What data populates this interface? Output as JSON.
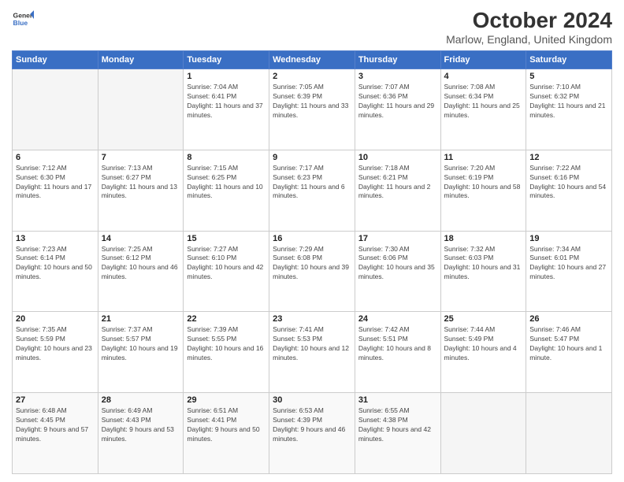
{
  "header": {
    "logo_line1": "General",
    "logo_line2": "Blue",
    "title": "October 2024",
    "subtitle": "Marlow, England, United Kingdom"
  },
  "weekdays": [
    "Sunday",
    "Monday",
    "Tuesday",
    "Wednesday",
    "Thursday",
    "Friday",
    "Saturday"
  ],
  "weeks": [
    [
      {
        "day": "",
        "info": ""
      },
      {
        "day": "",
        "info": ""
      },
      {
        "day": "1",
        "info": "Sunrise: 7:04 AM\nSunset: 6:41 PM\nDaylight: 11 hours and 37 minutes."
      },
      {
        "day": "2",
        "info": "Sunrise: 7:05 AM\nSunset: 6:39 PM\nDaylight: 11 hours and 33 minutes."
      },
      {
        "day": "3",
        "info": "Sunrise: 7:07 AM\nSunset: 6:36 PM\nDaylight: 11 hours and 29 minutes."
      },
      {
        "day": "4",
        "info": "Sunrise: 7:08 AM\nSunset: 6:34 PM\nDaylight: 11 hours and 25 minutes."
      },
      {
        "day": "5",
        "info": "Sunrise: 7:10 AM\nSunset: 6:32 PM\nDaylight: 11 hours and 21 minutes."
      }
    ],
    [
      {
        "day": "6",
        "info": "Sunrise: 7:12 AM\nSunset: 6:30 PM\nDaylight: 11 hours and 17 minutes."
      },
      {
        "day": "7",
        "info": "Sunrise: 7:13 AM\nSunset: 6:27 PM\nDaylight: 11 hours and 13 minutes."
      },
      {
        "day": "8",
        "info": "Sunrise: 7:15 AM\nSunset: 6:25 PM\nDaylight: 11 hours and 10 minutes."
      },
      {
        "day": "9",
        "info": "Sunrise: 7:17 AM\nSunset: 6:23 PM\nDaylight: 11 hours and 6 minutes."
      },
      {
        "day": "10",
        "info": "Sunrise: 7:18 AM\nSunset: 6:21 PM\nDaylight: 11 hours and 2 minutes."
      },
      {
        "day": "11",
        "info": "Sunrise: 7:20 AM\nSunset: 6:19 PM\nDaylight: 10 hours and 58 minutes."
      },
      {
        "day": "12",
        "info": "Sunrise: 7:22 AM\nSunset: 6:16 PM\nDaylight: 10 hours and 54 minutes."
      }
    ],
    [
      {
        "day": "13",
        "info": "Sunrise: 7:23 AM\nSunset: 6:14 PM\nDaylight: 10 hours and 50 minutes."
      },
      {
        "day": "14",
        "info": "Sunrise: 7:25 AM\nSunset: 6:12 PM\nDaylight: 10 hours and 46 minutes."
      },
      {
        "day": "15",
        "info": "Sunrise: 7:27 AM\nSunset: 6:10 PM\nDaylight: 10 hours and 42 minutes."
      },
      {
        "day": "16",
        "info": "Sunrise: 7:29 AM\nSunset: 6:08 PM\nDaylight: 10 hours and 39 minutes."
      },
      {
        "day": "17",
        "info": "Sunrise: 7:30 AM\nSunset: 6:06 PM\nDaylight: 10 hours and 35 minutes."
      },
      {
        "day": "18",
        "info": "Sunrise: 7:32 AM\nSunset: 6:03 PM\nDaylight: 10 hours and 31 minutes."
      },
      {
        "day": "19",
        "info": "Sunrise: 7:34 AM\nSunset: 6:01 PM\nDaylight: 10 hours and 27 minutes."
      }
    ],
    [
      {
        "day": "20",
        "info": "Sunrise: 7:35 AM\nSunset: 5:59 PM\nDaylight: 10 hours and 23 minutes."
      },
      {
        "day": "21",
        "info": "Sunrise: 7:37 AM\nSunset: 5:57 PM\nDaylight: 10 hours and 19 minutes."
      },
      {
        "day": "22",
        "info": "Sunrise: 7:39 AM\nSunset: 5:55 PM\nDaylight: 10 hours and 16 minutes."
      },
      {
        "day": "23",
        "info": "Sunrise: 7:41 AM\nSunset: 5:53 PM\nDaylight: 10 hours and 12 minutes."
      },
      {
        "day": "24",
        "info": "Sunrise: 7:42 AM\nSunset: 5:51 PM\nDaylight: 10 hours and 8 minutes."
      },
      {
        "day": "25",
        "info": "Sunrise: 7:44 AM\nSunset: 5:49 PM\nDaylight: 10 hours and 4 minutes."
      },
      {
        "day": "26",
        "info": "Sunrise: 7:46 AM\nSunset: 5:47 PM\nDaylight: 10 hours and 1 minute."
      }
    ],
    [
      {
        "day": "27",
        "info": "Sunrise: 6:48 AM\nSunset: 4:45 PM\nDaylight: 9 hours and 57 minutes."
      },
      {
        "day": "28",
        "info": "Sunrise: 6:49 AM\nSunset: 4:43 PM\nDaylight: 9 hours and 53 minutes."
      },
      {
        "day": "29",
        "info": "Sunrise: 6:51 AM\nSunset: 4:41 PM\nDaylight: 9 hours and 50 minutes."
      },
      {
        "day": "30",
        "info": "Sunrise: 6:53 AM\nSunset: 4:39 PM\nDaylight: 9 hours and 46 minutes."
      },
      {
        "day": "31",
        "info": "Sunrise: 6:55 AM\nSunset: 4:38 PM\nDaylight: 9 hours and 42 minutes."
      },
      {
        "day": "",
        "info": ""
      },
      {
        "day": "",
        "info": ""
      }
    ]
  ]
}
